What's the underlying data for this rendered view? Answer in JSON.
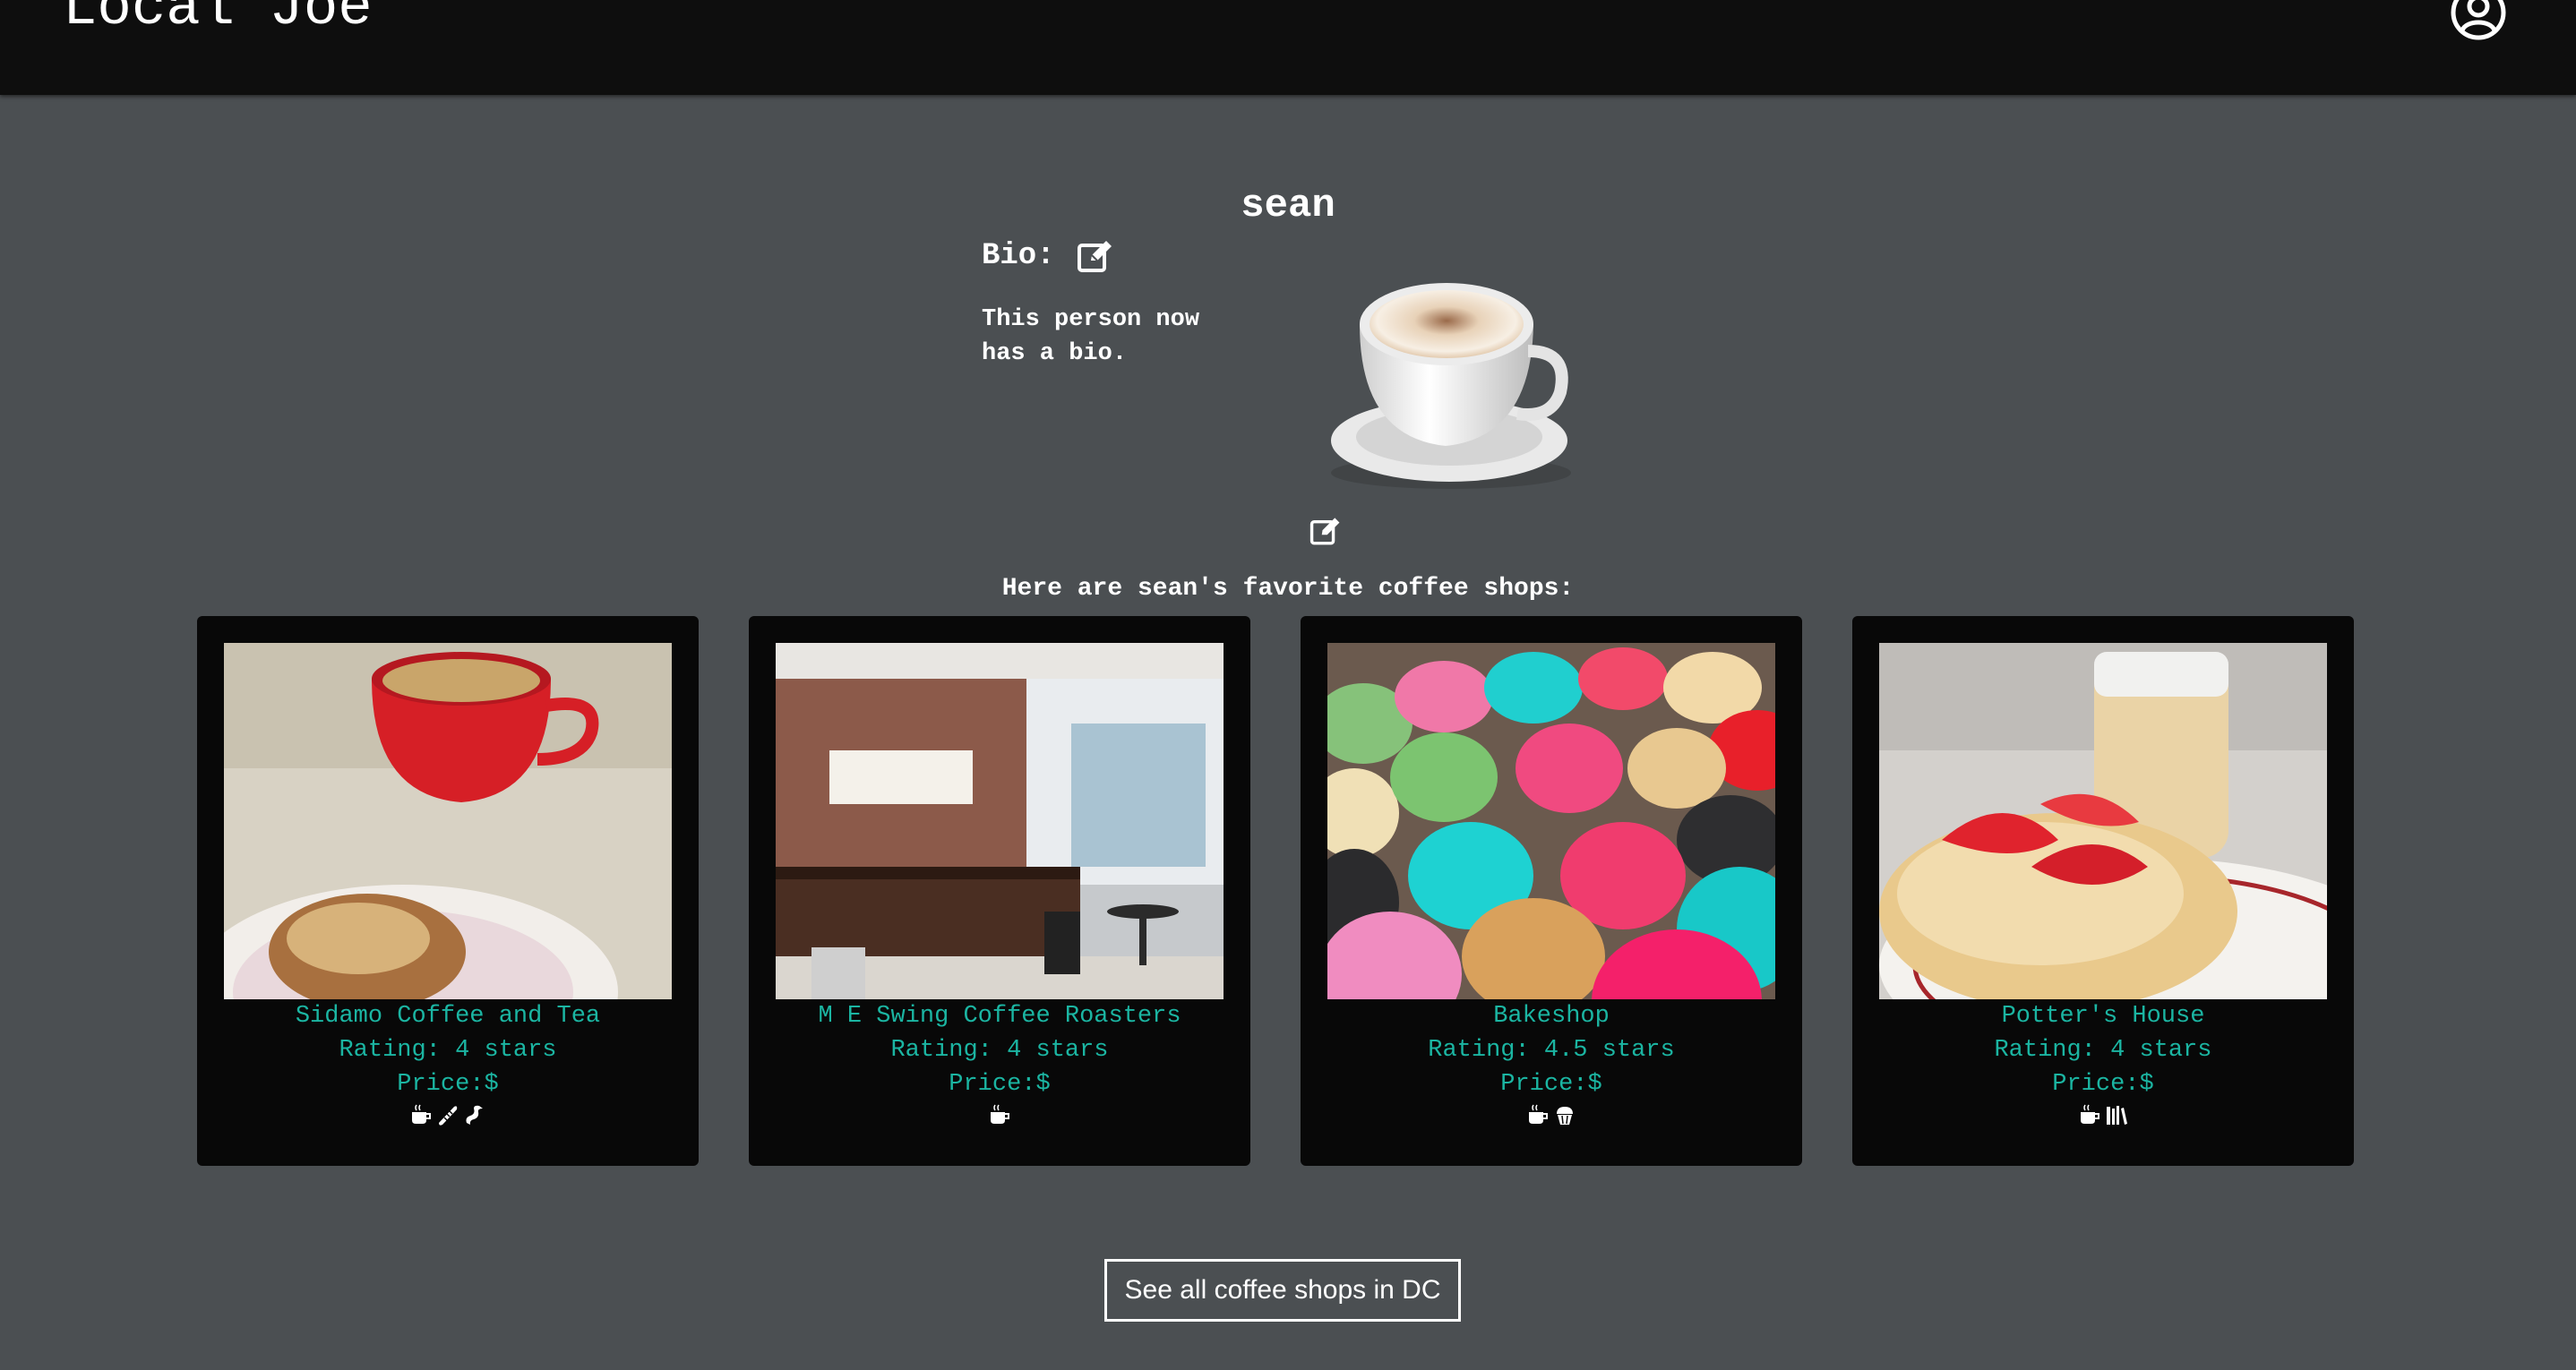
{
  "navbar": {
    "brand": "Local Joe",
    "account_icon": "user-circle-icon"
  },
  "profile": {
    "username": "sean",
    "bio_label": "Bio:",
    "bio_text": "This person now has a bio.",
    "bio_edit_icon": "edit-icon",
    "photo_edit_icon": "edit-icon",
    "avatar": "coffee-cup-image"
  },
  "favorites": {
    "heading": "Here are sean's favorite coffee shops:",
    "shops": [
      {
        "name": "Sidamo Coffee and Tea",
        "rating": "Rating: 4 stars",
        "price": "Price:$",
        "image": "coffee-and-pastry-photo",
        "amenities": [
          "coffee-icon",
          "baguette-icon",
          "bacon-icon"
        ]
      },
      {
        "name": "M E Swing Coffee Roasters",
        "rating": "Rating: 4 stars",
        "price": "Price:$",
        "image": "cafe-interior-photo",
        "amenities": [
          "coffee-icon"
        ]
      },
      {
        "name": "Bakeshop",
        "rating": "Rating: 4.5 stars",
        "price": "Price:$",
        "image": "macarons-photo",
        "amenities": [
          "coffee-icon",
          "cupcake-icon"
        ]
      },
      {
        "name": "Potter's House",
        "rating": "Rating: 4 stars",
        "price": "Price:$",
        "image": "scone-and-iced-coffee-photo",
        "amenities": [
          "coffee-icon",
          "books-icon"
        ]
      }
    ]
  },
  "see_all_button": "See all coffee shops in DC",
  "colors": {
    "page_background": "#4b4f52",
    "navbar_background": "#0e0e0e",
    "card_background": "#080808",
    "accent_teal": "#1bb5a2"
  }
}
